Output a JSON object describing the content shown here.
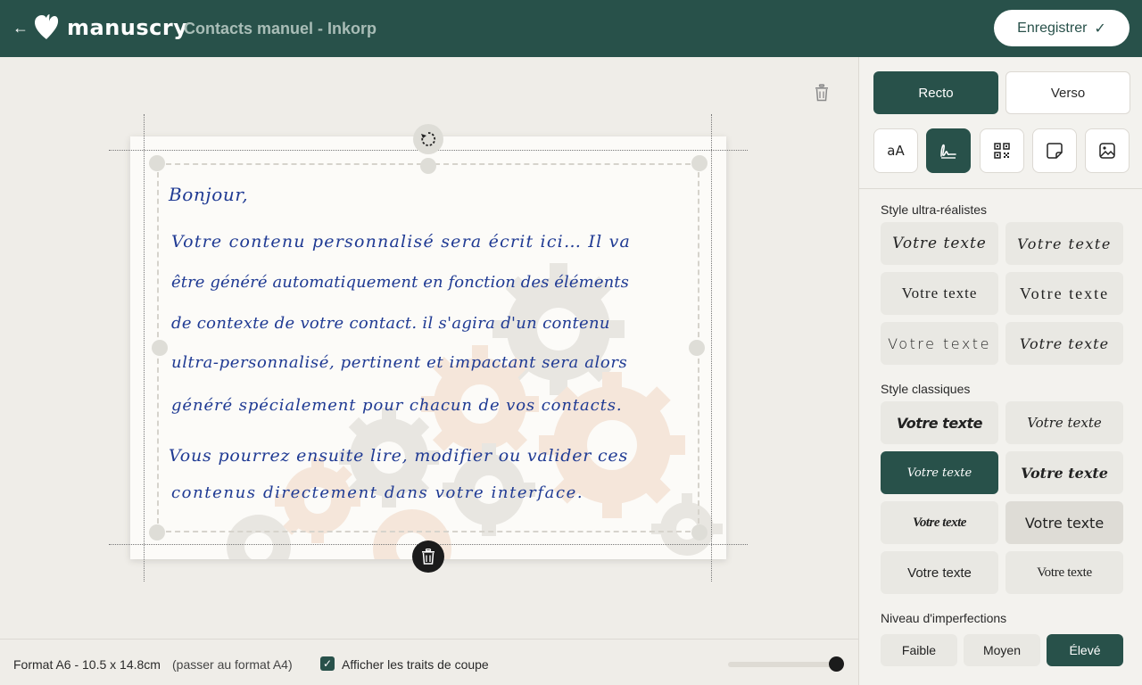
{
  "header": {
    "brand": "manuscry",
    "document_title": "Contacts manuel - Inkorp",
    "save_label": "Enregistrer"
  },
  "card": {
    "greeting": "Bonjour,",
    "lines": [
      "Votre contenu personnalisé sera écrit ici… Il va",
      "être généré automatiquement en fonction des éléments",
      "de contexte de votre contact. il s'agira d'un contenu",
      "ultra-personnalisé, pertinent et impactant sera alors",
      "généré spécialement pour chacun de vos contacts.",
      "Vous pourrez ensuite lire, modifier ou valider ces",
      "contenus directement dans votre interface."
    ]
  },
  "bottom_bar": {
    "format_label": "Format A6 - 10.5 x 14.8cm",
    "format_switch": "(passer au format A4)",
    "show_cut_lines_label": "Afficher les traits de coupe",
    "show_cut_lines_checked": true,
    "zoom_fraction": 1.0
  },
  "panel": {
    "side_tabs": [
      "Recto",
      "Verso"
    ],
    "active_side": "Recto",
    "tools": [
      {
        "icon": "text-size-icon",
        "label": "aA"
      },
      {
        "icon": "signature-icon",
        "label": ""
      },
      {
        "icon": "qr-code-icon",
        "label": ""
      },
      {
        "icon": "sticky-note-icon",
        "label": ""
      },
      {
        "icon": "image-icon",
        "label": ""
      }
    ],
    "active_tool": "signature-icon",
    "ultra_label": "Style ultra-réalistes",
    "ultra_styles": [
      "Votre texte",
      "Votre texte",
      "Votre texte",
      "Votre texte",
      "Votre texte",
      "Votre texte"
    ],
    "classic_label": "Style classiques",
    "classic_styles": [
      "Votre texte",
      "Votre texte",
      "Votre texte",
      "Votre texte",
      "Votre texte",
      "Votre texte",
      "Votre texte",
      "Votre texte"
    ],
    "classic_selected_index": 2,
    "imperfection_label": "Niveau d'imperfections",
    "imperfection_levels": [
      "Faible",
      "Moyen",
      "Élevé"
    ],
    "imperfection_active": "Élevé"
  },
  "colors": {
    "brand_green": "#28514a",
    "ink_blue": "#1f3a93",
    "canvas_bg": "#efede8"
  }
}
